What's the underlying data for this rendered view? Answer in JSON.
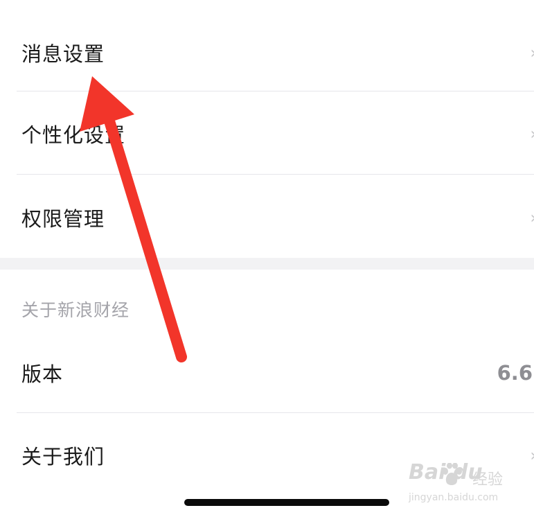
{
  "settings_top": [
    {
      "label": "消息设置"
    },
    {
      "label": "个性化设置"
    },
    {
      "label": "权限管理"
    }
  ],
  "about_section": {
    "header": "关于新浪财经",
    "version_label": "版本",
    "version_value": "6.6",
    "about_us_label": "关于我们"
  },
  "watermark": {
    "brand": "Bai du",
    "brand_suffix": "经验",
    "url": "jingyan.baidu.com"
  },
  "colors": {
    "annotation_arrow": "#f2352a",
    "divider": "#e5e5ea",
    "section_gap": "#f2f2f4",
    "secondary_text": "#a4a4aa"
  },
  "icons": {
    "chevron": "chevron-right-icon",
    "paw": "baidu-paw-icon"
  }
}
